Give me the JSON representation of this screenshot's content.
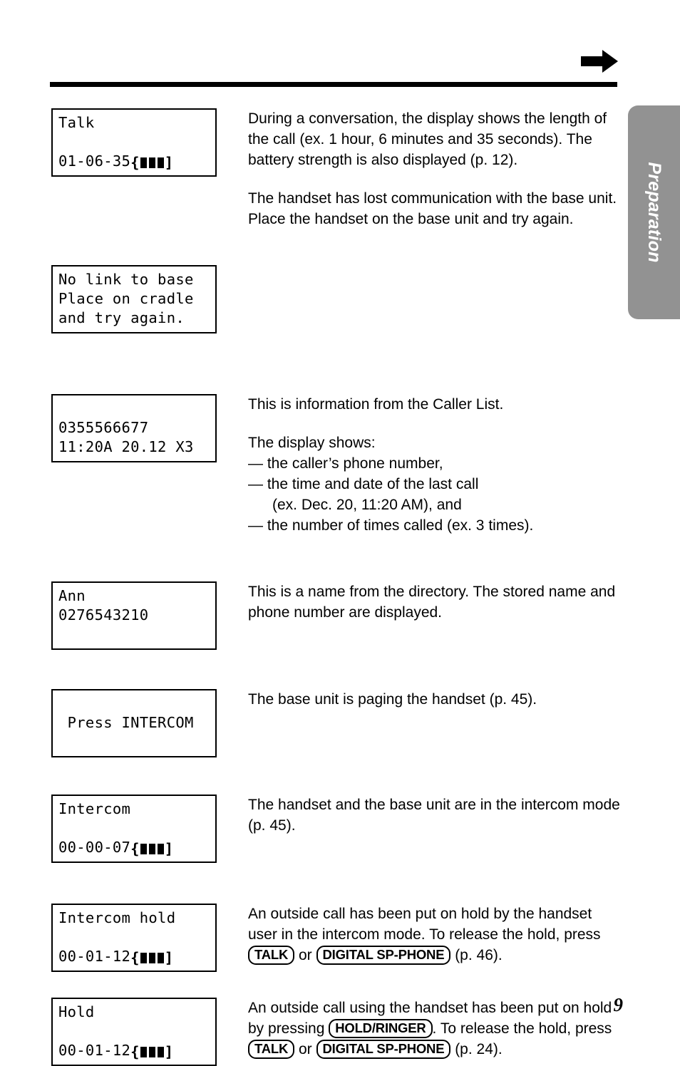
{
  "page": {
    "number": "9",
    "side_tab_label": "Preparation",
    "header_arrow_icon": "right-arrow-icon"
  },
  "entries": [
    {
      "id": "talk",
      "lcd": {
        "lines": [
          "Talk",
          "",
          "01-06-35"
        ],
        "battery": {
          "open": "{",
          "close": "]",
          "cells": 3
        },
        "battery_on_line": 2
      },
      "text": {
        "paragraphs": [
          "During a conversation, the display shows the length of the call (ex. 1 hour, 6 minutes and 35 seconds). The battery strength is also displayed (p. 12).",
          "The handset has lost communication with the base unit. Place the handset on the base unit and try again."
        ]
      }
    },
    {
      "id": "no-link-to-base",
      "lcd": {
        "lines": [
          "No link to base",
          "Place on cradle",
          "and try again."
        ],
        "battery": null
      }
    },
    {
      "id": "caller-list",
      "lcd": {
        "lines": [
          "",
          "0355566677",
          "11:20A 20.12 X3"
        ],
        "battery": null
      },
      "text": {
        "intro": [
          "This is information from the Caller List.",
          "The display shows:"
        ],
        "bullets": [
          {
            "dash": "—",
            "main": "the caller’s phone number,"
          },
          {
            "dash": "—",
            "main": "the time and date of the last call",
            "cont": "(ex. Dec. 20, 11:20 AM), and"
          },
          {
            "dash": "—",
            "main": "the number of times called (ex. 3 times)."
          }
        ]
      }
    },
    {
      "id": "directory-name",
      "lcd": {
        "lines": [
          "Ann",
          "0276543210",
          ""
        ],
        "battery": null
      },
      "text": {
        "paragraphs": [
          "This is a name from the directory. The stored name and phone number are displayed."
        ]
      }
    },
    {
      "id": "press-intercom",
      "lcd": {
        "lines": [
          "",
          " Press INTERCOM",
          ""
        ],
        "battery": null
      },
      "text": {
        "paragraphs": [
          "The base unit is paging the handset (p. 45)."
        ]
      }
    },
    {
      "id": "intercom",
      "lcd": {
        "lines": [
          "Intercom",
          "",
          "00-00-07"
        ],
        "battery": {
          "open": "{",
          "close": "]",
          "cells": 3
        },
        "battery_on_line": 2
      },
      "text": {
        "paragraphs": [
          "The handset and the base unit are in the intercom mode (p. 45)."
        ]
      }
    },
    {
      "id": "intercom-hold",
      "lcd": {
        "lines": [
          "Intercom hold",
          "",
          "00-01-12"
        ],
        "battery": {
          "open": "{",
          "close": "]",
          "cells": 3
        },
        "battery_on_line": 2
      },
      "text": {
        "segments": [
          {
            "t": "An outside call has been put on hold by the handset user in the intercom mode. To release the hold, press "
          },
          {
            "key": "TALK"
          },
          {
            "t": " or "
          },
          {
            "key": "DIGITAL SP-PHONE"
          },
          {
            "t": " (p. 46)."
          }
        ]
      }
    },
    {
      "id": "hold",
      "lcd": {
        "lines": [
          "Hold",
          "",
          "00-01-12"
        ],
        "battery": {
          "open": "{",
          "close": "]",
          "cells": 3
        },
        "battery_on_line": 2
      },
      "text": {
        "segments": [
          {
            "t": "An outside call using the handset has been put on hold by pressing "
          },
          {
            "key": "HOLD/RINGER"
          },
          {
            "t": ". To release the hold, press "
          },
          {
            "key": "TALK"
          },
          {
            "t": " or "
          },
          {
            "key": "DIGITAL SP-PHONE"
          },
          {
            "t": " (p. 24)."
          }
        ]
      }
    }
  ]
}
